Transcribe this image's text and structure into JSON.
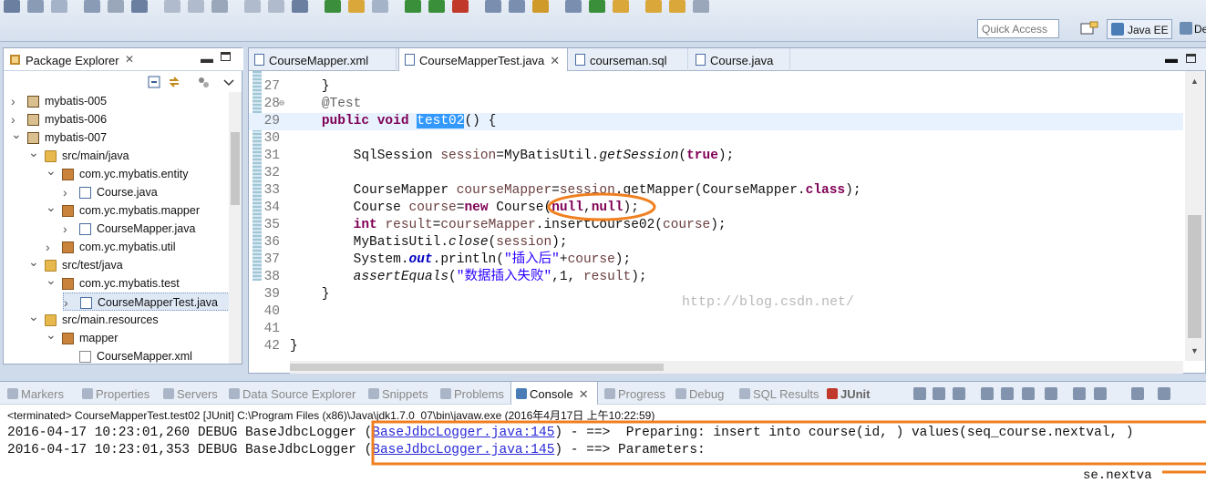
{
  "toolbar": {
    "quick_access_placeholder": "Quick Access",
    "perspective_active": "Java EE",
    "perspective_other": "De"
  },
  "package_explorer": {
    "title": "Package Explorer",
    "tree": [
      {
        "label": "mybatis-005",
        "depth": 0,
        "twisty": "closed",
        "icon": "project-icon"
      },
      {
        "label": "mybatis-006",
        "depth": 0,
        "twisty": "closed",
        "icon": "project-icon"
      },
      {
        "label": "mybatis-007",
        "depth": 0,
        "twisty": "open",
        "icon": "project-icon"
      },
      {
        "label": "src/main/java",
        "depth": 1,
        "twisty": "open",
        "icon": "source-folder-icon"
      },
      {
        "label": "com.yc.mybatis.entity",
        "depth": 2,
        "twisty": "open",
        "icon": "package-icon"
      },
      {
        "label": "Course.java",
        "depth": 3,
        "twisty": "closed",
        "icon": "java-file-icon"
      },
      {
        "label": "com.yc.mybatis.mapper",
        "depth": 2,
        "twisty": "open",
        "icon": "package-icon"
      },
      {
        "label": "CourseMapper.java",
        "depth": 3,
        "twisty": "closed",
        "icon": "java-file-icon"
      },
      {
        "label": "com.yc.mybatis.util",
        "depth": 2,
        "twisty": "closed",
        "icon": "package-icon"
      },
      {
        "label": "src/test/java",
        "depth": 1,
        "twisty": "open",
        "icon": "source-folder-icon"
      },
      {
        "label": "com.yc.mybatis.test",
        "depth": 2,
        "twisty": "open",
        "icon": "package-icon"
      },
      {
        "label": "CourseMapperTest.java",
        "depth": 3,
        "twisty": "closed",
        "icon": "java-file-icon",
        "selected": true
      },
      {
        "label": "src/main.resources",
        "depth": 1,
        "twisty": "open",
        "icon": "source-folder-icon"
      },
      {
        "label": "mapper",
        "depth": 2,
        "twisty": "open",
        "icon": "package-icon"
      },
      {
        "label": "CourseMapper.xml",
        "depth": 3,
        "twisty": "none",
        "icon": "xml-file-icon"
      }
    ]
  },
  "editor": {
    "tabs": [
      {
        "label": "CourseMapper.xml",
        "active": false
      },
      {
        "label": "CourseMapperTest.java",
        "active": true
      },
      {
        "label": "courseman.sql",
        "active": false
      },
      {
        "label": "Course.java",
        "active": false
      }
    ],
    "lines": [
      {
        "n": "27",
        "html": "    }"
      },
      {
        "n": "28",
        "html": "    <span class=\"ann\">@Test</span>",
        "fold": true
      },
      {
        "n": "29",
        "html": "    <span class=\"kw\">public</span> <span class=\"kw\">void</span> <span class=\"hl\">test02</span>() {",
        "current": true
      },
      {
        "n": "30",
        "html": ""
      },
      {
        "n": "31",
        "html": "        SqlSession <span class=\"var\">session</span>=MyBatisUtil.<span class=\"st\">getSession</span>(<span class=\"kw\">true</span>);"
      },
      {
        "n": "32",
        "html": ""
      },
      {
        "n": "33",
        "html": "        CourseMapper <span class=\"var\">courseMapper</span>=<span class=\"var\">session</span>.getMapper(CourseMapper.<span class=\"kw\">class</span>);"
      },
      {
        "n": "34",
        "html": "        Course <span class=\"var\">course</span>=<span class=\"kw\">new</span> Course(<span class=\"kw\">null</span>,<span class=\"kw\">null</span>);"
      },
      {
        "n": "35",
        "html": "        <span class=\"kw\">int</span> <span class=\"var\">result</span>=<span class=\"var\">courseMapper</span>.insertCourse02(<span class=\"var\">course</span>);"
      },
      {
        "n": "36",
        "html": "        MyBatisUtil.<span class=\"st\">close</span>(<span class=\"var\">session</span>);"
      },
      {
        "n": "37",
        "html": "        System.<span class=\"fld\">out</span>.println(<span class=\"str\">\"插入后\"</span>+<span class=\"var\">course</span>);"
      },
      {
        "n": "38",
        "html": "        <span class=\"st\">assertEquals</span>(<span class=\"str\">\"数据插入失败\"</span>,1, <span class=\"var\">result</span>);"
      },
      {
        "n": "39",
        "html": "    }"
      },
      {
        "n": "40",
        "html": ""
      },
      {
        "n": "41",
        "html": ""
      },
      {
        "n": "42",
        "html": "}"
      }
    ],
    "watermark": "http://blog.csdn.net/"
  },
  "bottom": {
    "tabs": [
      "Markers",
      "Properties",
      "Servers",
      "Data Source Explorer",
      "Snippets",
      "Problems",
      "Console",
      "Progress",
      "Debug",
      "SQL Results",
      "JUnit"
    ],
    "active_tab": "Console",
    "status": "<terminated> CourseMapperTest.test02 [JUnit] C:\\Program Files (x86)\\Java\\jdk1.7.0_07\\bin\\javaw.exe (2016年4月17日 上午10:22:59)",
    "console_lines": [
      {
        "prefix": "2016-04-17 10:23:01,260 DEBUG BaseJdbcLogger (",
        "link": "BaseJdbcLogger.java:145",
        "suffix": ") - ==>  Preparing: insert into course(id, ) values(seq_course.nextval, )"
      },
      {
        "prefix": "2016-04-17 10:23:01,353 DEBUG BaseJdbcLogger (",
        "link": "BaseJdbcLogger.java:145",
        "suffix": ") - ==> Parameters: "
      }
    ],
    "fragment": "se.nextva"
  }
}
